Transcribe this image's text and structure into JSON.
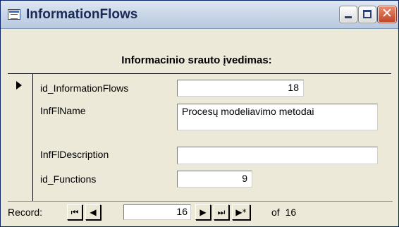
{
  "window": {
    "title": "InformationFlows"
  },
  "form": {
    "header": "Informacinio srauto įvedimas:"
  },
  "fields": [
    {
      "label": "id_InformationFlows",
      "value": "18"
    },
    {
      "label": "InfFlName",
      "value": "Procesų modeliavimo metodai"
    },
    {
      "label": "InfFlDescription",
      "value": ""
    },
    {
      "label": "id_Functions",
      "value": "9"
    }
  ],
  "navigation": {
    "record_label": "Record:",
    "current_record": "16",
    "of_label": "of",
    "total_records": "16",
    "buttons": {
      "first": "⏮",
      "previous": "◀",
      "next": "▶",
      "last": "⏭",
      "new": "▶*"
    }
  }
}
